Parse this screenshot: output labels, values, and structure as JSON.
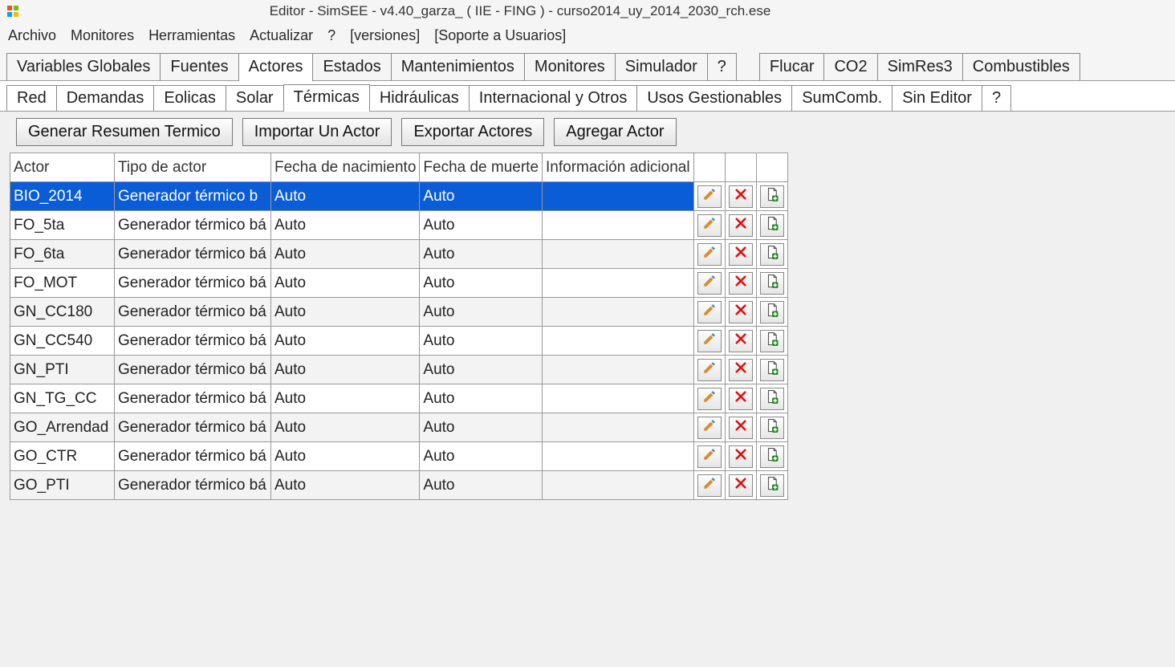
{
  "window": {
    "title": "Editor - SimSEE - v4.40_garza_ ( IIE - FING ) - curso2014_uy_2014_2030_rch.ese"
  },
  "menu": {
    "items": [
      "Archivo",
      "Monitores",
      "Herramientas",
      "Actualizar",
      "?",
      "[versiones]",
      "[Soporte a Usuarios]"
    ]
  },
  "tabs_main": {
    "items": [
      "Variables Globales",
      "Fuentes",
      "Actores",
      "Estados",
      "Mantenimientos",
      "Monitores",
      "Simulador",
      "?"
    ],
    "items2": [
      "Flucar",
      "CO2",
      "SimRes3",
      "Combustibles"
    ],
    "active": 2
  },
  "tabs_sub": {
    "items": [
      "Red",
      "Demandas",
      "Eolicas",
      "Solar",
      "Térmicas",
      "Hidráulicas",
      "Internacional y Otros",
      "Usos Gestionables",
      "SumComb.",
      "Sin Editor",
      "?"
    ],
    "active": 4
  },
  "toolbar": {
    "btn_resumen": "Generar Resumen Termico",
    "btn_importar": "Importar Un Actor",
    "btn_exportar": "Exportar Actores",
    "btn_agregar": "Agregar Actor"
  },
  "grid": {
    "headers": {
      "actor": "Actor",
      "tipo": "Tipo de actor",
      "fnac": "Fecha de nacimiento",
      "fmuer": "Fecha de muerte",
      "info": "Información adicional"
    },
    "rows": [
      {
        "actor": "BIO_2014",
        "tipo": "Generador térmico b",
        "fnac": "Auto",
        "fmuer": "Auto",
        "info": "",
        "selected": true
      },
      {
        "actor": "FO_5ta",
        "tipo": "Generador térmico bá",
        "fnac": "Auto",
        "fmuer": "Auto",
        "info": ""
      },
      {
        "actor": "FO_6ta",
        "tipo": "Generador térmico bá",
        "fnac": "Auto",
        "fmuer": "Auto",
        "info": ""
      },
      {
        "actor": "FO_MOT",
        "tipo": "Generador térmico bá",
        "fnac": "Auto",
        "fmuer": "Auto",
        "info": ""
      },
      {
        "actor": "GN_CC180",
        "tipo": "Generador térmico bá",
        "fnac": "Auto",
        "fmuer": "Auto",
        "info": ""
      },
      {
        "actor": "GN_CC540",
        "tipo": "Generador térmico bá",
        "fnac": "Auto",
        "fmuer": "Auto",
        "info": ""
      },
      {
        "actor": "GN_PTI",
        "tipo": "Generador térmico bá",
        "fnac": "Auto",
        "fmuer": "Auto",
        "info": ""
      },
      {
        "actor": "GN_TG_CC",
        "tipo": "Generador térmico bá",
        "fnac": "Auto",
        "fmuer": "Auto",
        "info": ""
      },
      {
        "actor": "GO_Arrendad",
        "tipo": "Generador térmico bá",
        "fnac": "Auto",
        "fmuer": "Auto",
        "info": ""
      },
      {
        "actor": "GO_CTR",
        "tipo": "Generador térmico bá",
        "fnac": "Auto",
        "fmuer": "Auto",
        "info": ""
      },
      {
        "actor": "GO_PTI",
        "tipo": "Generador térmico bá",
        "fnac": "Auto",
        "fmuer": "Auto",
        "info": ""
      }
    ]
  },
  "icons": {
    "edit": "pencil-icon",
    "delete": "x-icon",
    "clone": "page-plus-icon"
  }
}
